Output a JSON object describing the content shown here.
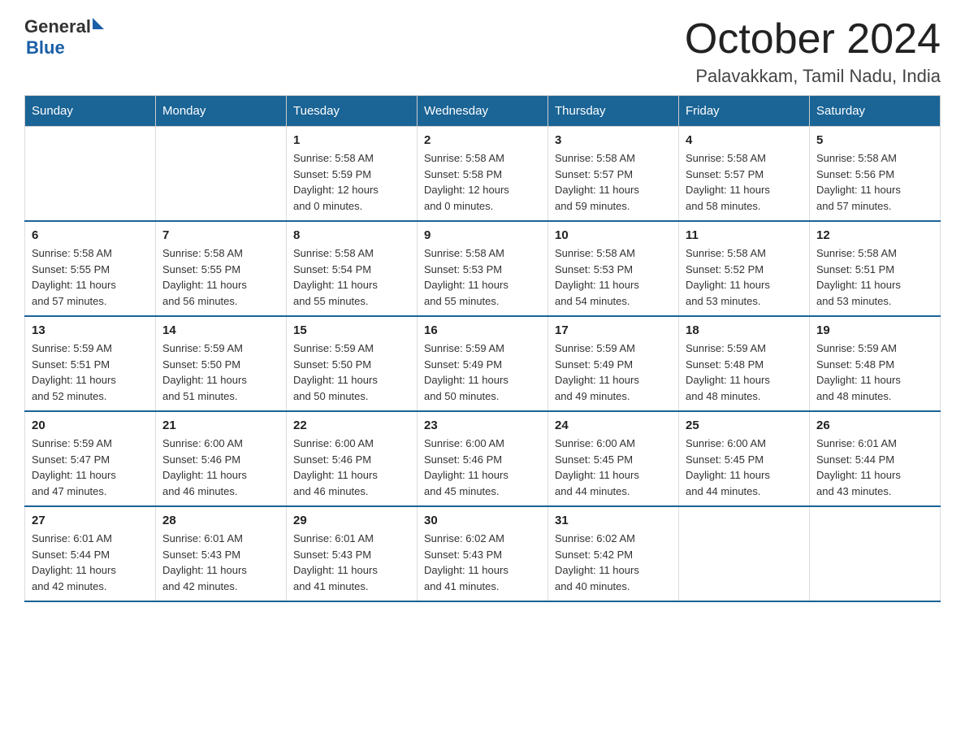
{
  "header": {
    "logo_general": "General",
    "logo_blue": "Blue",
    "month": "October 2024",
    "location": "Palavakkam, Tamil Nadu, India"
  },
  "weekdays": [
    "Sunday",
    "Monday",
    "Tuesday",
    "Wednesday",
    "Thursday",
    "Friday",
    "Saturday"
  ],
  "weeks": [
    [
      {
        "day": "",
        "info": ""
      },
      {
        "day": "",
        "info": ""
      },
      {
        "day": "1",
        "info": "Sunrise: 5:58 AM\nSunset: 5:59 PM\nDaylight: 12 hours\nand 0 minutes."
      },
      {
        "day": "2",
        "info": "Sunrise: 5:58 AM\nSunset: 5:58 PM\nDaylight: 12 hours\nand 0 minutes."
      },
      {
        "day": "3",
        "info": "Sunrise: 5:58 AM\nSunset: 5:57 PM\nDaylight: 11 hours\nand 59 minutes."
      },
      {
        "day": "4",
        "info": "Sunrise: 5:58 AM\nSunset: 5:57 PM\nDaylight: 11 hours\nand 58 minutes."
      },
      {
        "day": "5",
        "info": "Sunrise: 5:58 AM\nSunset: 5:56 PM\nDaylight: 11 hours\nand 57 minutes."
      }
    ],
    [
      {
        "day": "6",
        "info": "Sunrise: 5:58 AM\nSunset: 5:55 PM\nDaylight: 11 hours\nand 57 minutes."
      },
      {
        "day": "7",
        "info": "Sunrise: 5:58 AM\nSunset: 5:55 PM\nDaylight: 11 hours\nand 56 minutes."
      },
      {
        "day": "8",
        "info": "Sunrise: 5:58 AM\nSunset: 5:54 PM\nDaylight: 11 hours\nand 55 minutes."
      },
      {
        "day": "9",
        "info": "Sunrise: 5:58 AM\nSunset: 5:53 PM\nDaylight: 11 hours\nand 55 minutes."
      },
      {
        "day": "10",
        "info": "Sunrise: 5:58 AM\nSunset: 5:53 PM\nDaylight: 11 hours\nand 54 minutes."
      },
      {
        "day": "11",
        "info": "Sunrise: 5:58 AM\nSunset: 5:52 PM\nDaylight: 11 hours\nand 53 minutes."
      },
      {
        "day": "12",
        "info": "Sunrise: 5:58 AM\nSunset: 5:51 PM\nDaylight: 11 hours\nand 53 minutes."
      }
    ],
    [
      {
        "day": "13",
        "info": "Sunrise: 5:59 AM\nSunset: 5:51 PM\nDaylight: 11 hours\nand 52 minutes."
      },
      {
        "day": "14",
        "info": "Sunrise: 5:59 AM\nSunset: 5:50 PM\nDaylight: 11 hours\nand 51 minutes."
      },
      {
        "day": "15",
        "info": "Sunrise: 5:59 AM\nSunset: 5:50 PM\nDaylight: 11 hours\nand 50 minutes."
      },
      {
        "day": "16",
        "info": "Sunrise: 5:59 AM\nSunset: 5:49 PM\nDaylight: 11 hours\nand 50 minutes."
      },
      {
        "day": "17",
        "info": "Sunrise: 5:59 AM\nSunset: 5:49 PM\nDaylight: 11 hours\nand 49 minutes."
      },
      {
        "day": "18",
        "info": "Sunrise: 5:59 AM\nSunset: 5:48 PM\nDaylight: 11 hours\nand 48 minutes."
      },
      {
        "day": "19",
        "info": "Sunrise: 5:59 AM\nSunset: 5:48 PM\nDaylight: 11 hours\nand 48 minutes."
      }
    ],
    [
      {
        "day": "20",
        "info": "Sunrise: 5:59 AM\nSunset: 5:47 PM\nDaylight: 11 hours\nand 47 minutes."
      },
      {
        "day": "21",
        "info": "Sunrise: 6:00 AM\nSunset: 5:46 PM\nDaylight: 11 hours\nand 46 minutes."
      },
      {
        "day": "22",
        "info": "Sunrise: 6:00 AM\nSunset: 5:46 PM\nDaylight: 11 hours\nand 46 minutes."
      },
      {
        "day": "23",
        "info": "Sunrise: 6:00 AM\nSunset: 5:46 PM\nDaylight: 11 hours\nand 45 minutes."
      },
      {
        "day": "24",
        "info": "Sunrise: 6:00 AM\nSunset: 5:45 PM\nDaylight: 11 hours\nand 44 minutes."
      },
      {
        "day": "25",
        "info": "Sunrise: 6:00 AM\nSunset: 5:45 PM\nDaylight: 11 hours\nand 44 minutes."
      },
      {
        "day": "26",
        "info": "Sunrise: 6:01 AM\nSunset: 5:44 PM\nDaylight: 11 hours\nand 43 minutes."
      }
    ],
    [
      {
        "day": "27",
        "info": "Sunrise: 6:01 AM\nSunset: 5:44 PM\nDaylight: 11 hours\nand 42 minutes."
      },
      {
        "day": "28",
        "info": "Sunrise: 6:01 AM\nSunset: 5:43 PM\nDaylight: 11 hours\nand 42 minutes."
      },
      {
        "day": "29",
        "info": "Sunrise: 6:01 AM\nSunset: 5:43 PM\nDaylight: 11 hours\nand 41 minutes."
      },
      {
        "day": "30",
        "info": "Sunrise: 6:02 AM\nSunset: 5:43 PM\nDaylight: 11 hours\nand 41 minutes."
      },
      {
        "day": "31",
        "info": "Sunrise: 6:02 AM\nSunset: 5:42 PM\nDaylight: 11 hours\nand 40 minutes."
      },
      {
        "day": "",
        "info": ""
      },
      {
        "day": "",
        "info": ""
      }
    ]
  ]
}
